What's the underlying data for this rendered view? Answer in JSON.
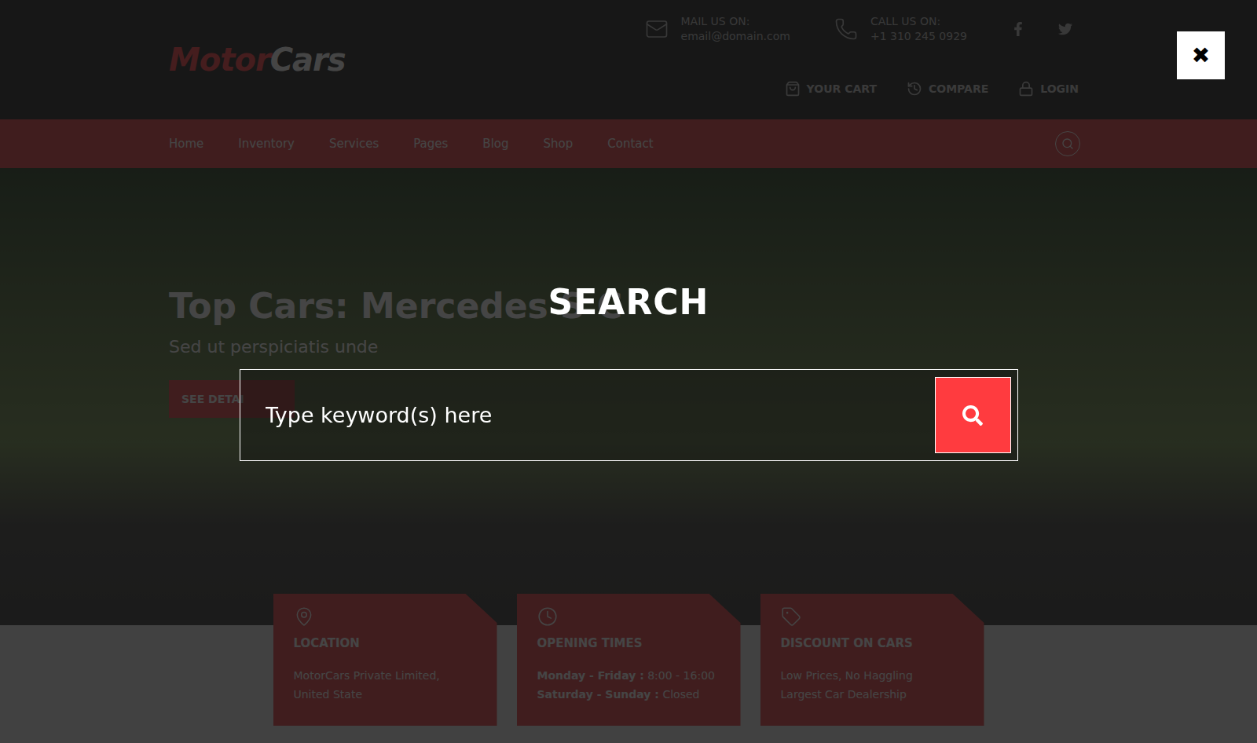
{
  "header": {
    "logo": {
      "first": "Motor",
      "second": "Cars"
    },
    "contacts": [
      {
        "label": "MAIL US ON:",
        "value": "email@domain.com",
        "kind": "mail"
      },
      {
        "label": "CALL US ON:",
        "value": "+1 310 245 0929",
        "kind": "phone"
      }
    ],
    "account_links": [
      {
        "label": "YOUR CART",
        "kind": "cart"
      },
      {
        "label": "COMPARE",
        "kind": "compare"
      },
      {
        "label": "LOGIN",
        "kind": "login"
      }
    ]
  },
  "nav": {
    "items": [
      "Home",
      "Inventory",
      "Services",
      "Pages",
      "Blog",
      "Shop",
      "Contact"
    ]
  },
  "hero": {
    "title": "Top Cars: Mercedes S C",
    "subtitle": "Sed ut perspiciatis unde",
    "button": "SEE DETAI"
  },
  "cards": [
    {
      "title": "LOCATION",
      "kind": "location",
      "lines": [
        "MotorCars Private Limited,",
        "United State"
      ],
      "hours": []
    },
    {
      "title": "OPENING TIMES",
      "kind": "hours",
      "lines": [],
      "hours": [
        {
          "days": "Monday - Friday :",
          "time": "8:00 - 16:00"
        },
        {
          "days": "Saturday - Sunday :",
          "time": "Closed"
        }
      ]
    },
    {
      "title": "DISCOUNT ON CARS",
      "kind": "discount",
      "lines": [
        "Low Prices, No Haggling",
        "Largest Car Dealership"
      ],
      "hours": []
    }
  ],
  "search_overlay": {
    "title": "SEARCH",
    "placeholder": "Type keyword(s) here",
    "close": "✖"
  }
}
